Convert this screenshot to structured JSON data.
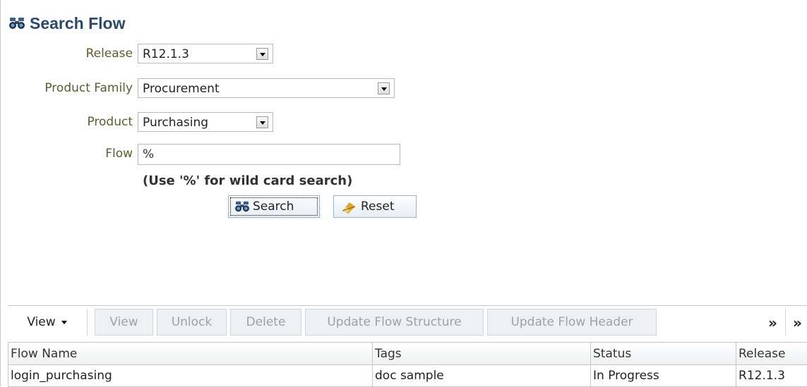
{
  "page": {
    "title": "Search Flow"
  },
  "form": {
    "release": {
      "label": "Release",
      "value": "R12.1.3"
    },
    "product_family": {
      "label": "Product Family",
      "value": "Procurement"
    },
    "product": {
      "label": "Product",
      "value": "Purchasing"
    },
    "flow": {
      "label": "Flow",
      "value": "%"
    },
    "hint": "(Use '%' for wild card search)",
    "search_label": "Search",
    "reset_label": "Reset"
  },
  "toolbar": {
    "view_menu": "View",
    "items": [
      "View",
      "Unlock",
      "Delete",
      "Update Flow Structure",
      "Update Flow Header"
    ],
    "more": "»"
  },
  "table": {
    "columns": [
      "Flow Name",
      "Tags",
      "Status",
      "Release"
    ],
    "rows": [
      {
        "flow_name": "login_purchasing",
        "tags": "doc sample",
        "status": "In Progress",
        "release": "R12.1.3"
      }
    ]
  },
  "icons": {
    "title_icon": "binoculars-icon",
    "search_icon": "binoculars-icon",
    "reset_icon": "eraser-icon",
    "dropdown_icon": "chevron-down-icon"
  }
}
